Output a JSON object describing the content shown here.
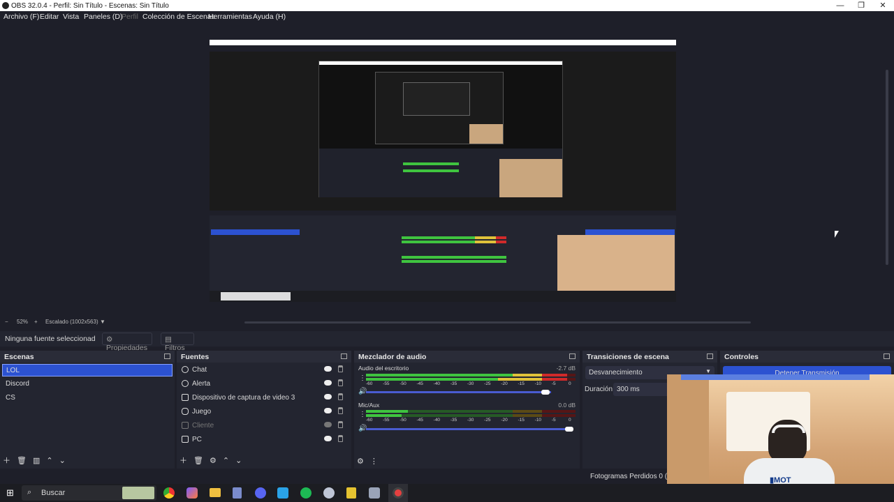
{
  "window": {
    "title": "OBS 32.0.4 - Perfil: Sin Título - Escenas: Sin Título"
  },
  "menu": [
    {
      "label": "Archivo (F)",
      "dim": false
    },
    {
      "label": "Editar",
      "dim": false
    },
    {
      "label": "Vista",
      "dim": false
    },
    {
      "label": "Paneles (D)",
      "dim": false
    },
    {
      "label": "Perfil",
      "dim": true
    },
    {
      "label": "Colección de Escenas",
      "dim": false
    },
    {
      "label": "Herramientas",
      "dim": false
    },
    {
      "label": "Ayuda (H)",
      "dim": false
    }
  ],
  "zoom": {
    "minus": "−",
    "percent": "52%",
    "plus": "+",
    "mode": "Escalado (1002x563)"
  },
  "source_bar": {
    "status": "Ninguna fuente seleccionad",
    "properties": "Propiedades",
    "filters": "Filtros"
  },
  "scenes": {
    "title": "Escenas",
    "items": [
      "LOL",
      "Discord",
      "CS"
    ],
    "selected": "LOL"
  },
  "sources": {
    "title": "Fuentes",
    "items": [
      {
        "label": "Chat",
        "visible": true
      },
      {
        "label": "Alerta",
        "visible": true
      },
      {
        "label": "Dispositivo de captura de video 3",
        "visible": true
      },
      {
        "label": "Juego",
        "visible": true
      },
      {
        "label": "Cliente",
        "visible": false
      },
      {
        "label": "PC",
        "visible": true
      }
    ]
  },
  "mixer": {
    "title": "Mezclador de audio",
    "channels": [
      {
        "name": "Audio del escritorio",
        "db": "-2.7 dB",
        "volume": 0.93
      },
      {
        "name": "Mic/Aux",
        "db": "0.0 dB",
        "volume": 1.0
      }
    ],
    "ticks": [
      "-60",
      "-55",
      "-50",
      "-45",
      "-40",
      "-35",
      "-30",
      "-25",
      "-20",
      "-15",
      "-10",
      "-5",
      "0"
    ]
  },
  "transitions": {
    "title": "Transiciones de escena",
    "selected": "Desvanecimiento",
    "duration_label": "Duración",
    "duration_value": "300 ms"
  },
  "controls": {
    "title": "Controles",
    "stop_stream": "Detener Transmisión"
  },
  "status": {
    "dropped_frames": "Fotogramas Perdidos 0 (0.0"
  },
  "taskbar": {
    "search_placeholder": "Buscar"
  },
  "colors": {
    "accent": "#2c52d1",
    "meter_green": "#3fc43f",
    "meter_yellow": "#e0c23a",
    "meter_red": "#d02a2a",
    "bg": "#1e1f29"
  }
}
